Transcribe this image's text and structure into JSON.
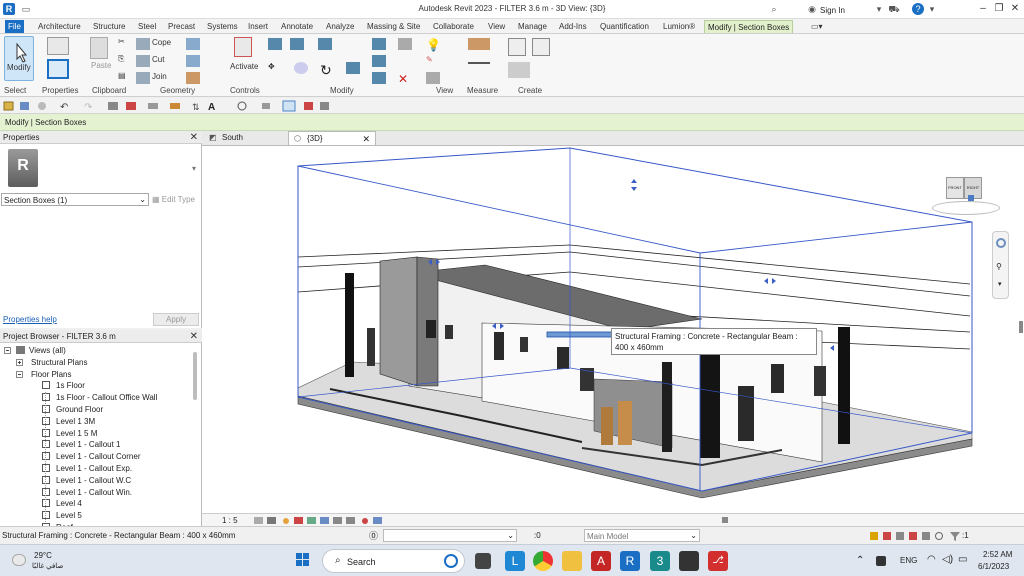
{
  "titlebar": {
    "title": "Autodesk Revit 2023 - FILTER 3.6 m - 3D View: {3D}",
    "sign_in": "Sign In"
  },
  "tabs": [
    "File",
    "Architecture",
    "Structure",
    "Steel",
    "Precast",
    "Systems",
    "Insert",
    "Annotate",
    "Analyze",
    "Massing & Site",
    "Collaborate",
    "View",
    "Manage",
    "Add-Ins",
    "Quantification",
    "Lumion®",
    "Modify | Section Boxes"
  ],
  "ribbon": {
    "modify": "Modify",
    "paste": "Paste",
    "cope": "Cope",
    "cut": "Cut",
    "join": "Join",
    "activate": "Activate",
    "panels": [
      "Select",
      "Properties",
      "Clipboard",
      "Geometry",
      "Controls",
      "Modify",
      "View",
      "Measure",
      "Create"
    ]
  },
  "context_bar": "Modify | Section Boxes",
  "properties": {
    "header": "Properties",
    "type_selector": "Section Boxes (1)",
    "edit_type": "Edit Type",
    "help": "Properties help",
    "apply": "Apply"
  },
  "browser": {
    "header": "Project Browser - FILTER 3.6 m",
    "items": [
      {
        "label": "Views (all)",
        "level": 0,
        "expander": "minus"
      },
      {
        "label": "Structural Plans",
        "level": 1,
        "expander": "plus"
      },
      {
        "label": "Floor Plans",
        "level": 1,
        "expander": "minus"
      },
      {
        "label": "1s Floor",
        "level": 2
      },
      {
        "label": "1s Floor - Callout Office Wall",
        "level": 2
      },
      {
        "label": "Ground Floor",
        "level": 2
      },
      {
        "label": "Level 1 3M",
        "level": 2
      },
      {
        "label": "Level 1 5 M",
        "level": 2
      },
      {
        "label": "Level 1 - Callout 1",
        "level": 2
      },
      {
        "label": "Level 1 - Callout Corner",
        "level": 2
      },
      {
        "label": "Level 1 - Callout Exp.",
        "level": 2
      },
      {
        "label": "Level 1 - Callout W.C",
        "level": 2
      },
      {
        "label": "Level 1 - Callout Win.",
        "level": 2
      },
      {
        "label": "Level 4",
        "level": 2
      },
      {
        "label": "Level 5",
        "level": 2
      },
      {
        "label": "Roof",
        "level": 2
      }
    ]
  },
  "view_tabs": [
    {
      "label": "South",
      "active": false
    },
    {
      "label": "{3D}",
      "active": true
    }
  ],
  "viewport": {
    "tooltip": "Structural Framing : Concrete - Rectangular Beam : 400 x 460mm",
    "scale": "1 : 5",
    "cube_front": "FRONT",
    "cube_right": "RIGHT"
  },
  "status": {
    "text": "Structural Framing : Concrete - Rectangular Beam : 400 x 460mm",
    "filter_value": ":0",
    "model": "Main Model",
    "filter_count": ":1"
  },
  "taskbar": {
    "temp": "29°C",
    "weather": "صافي غالبًا",
    "search": "Search",
    "lang": "ENG",
    "time": "2:52 AM",
    "date": "6/1/2023"
  },
  "colors": {
    "accent": "#1a6fc4",
    "context_green": "#e5f2d2",
    "section_box": "#3557c8"
  }
}
